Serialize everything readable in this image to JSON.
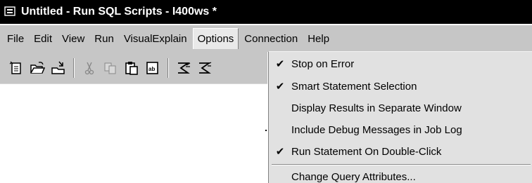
{
  "window": {
    "title": "Untitled - Run SQL Scripts - I400ws *"
  },
  "menubar": {
    "items": [
      {
        "label": "File",
        "open": false
      },
      {
        "label": "Edit",
        "open": false
      },
      {
        "label": "View",
        "open": false
      },
      {
        "label": "Run",
        "open": false
      },
      {
        "label": "VisualExplain",
        "open": false
      },
      {
        "label": "Options",
        "open": true
      },
      {
        "label": "Connection",
        "open": false
      },
      {
        "label": "Help",
        "open": false
      }
    ]
  },
  "toolbar": {
    "buttons": [
      "new-icon",
      "open-icon",
      "save-icon",
      "cut-icon",
      "copy-icon",
      "paste-icon",
      "find-icon",
      "run-all-icon",
      "run-selected-icon"
    ]
  },
  "options_menu": {
    "items": [
      {
        "label": "Stop on Error",
        "checked": true
      },
      {
        "label": "Smart Statement Selection",
        "checked": true
      },
      {
        "label": "Display Results in Separate Window",
        "checked": false
      },
      {
        "label": "Include Debug Messages in Job Log",
        "checked": false
      },
      {
        "label": "Run Statement On Double-Click",
        "checked": true
      }
    ],
    "footer_item": {
      "label": "Change Query Attributes..."
    },
    "check_glyph": "✔"
  }
}
